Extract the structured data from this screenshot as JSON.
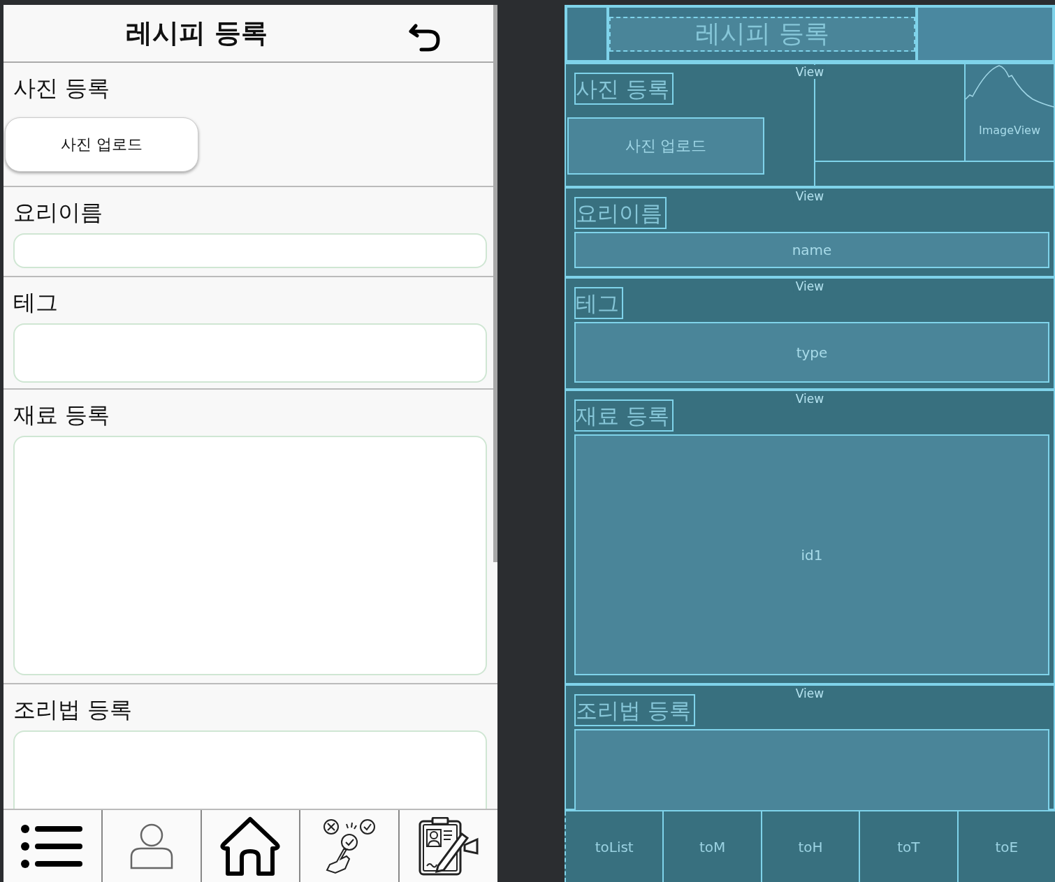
{
  "design": {
    "title": "레시피 등록",
    "sections": [
      {
        "kind": "photo",
        "label": "사진 등록",
        "button": "사진 업로드"
      },
      {
        "kind": "field",
        "label": "요리이름"
      },
      {
        "kind": "field",
        "label": "테그"
      },
      {
        "kind": "field",
        "label": "재료 등록"
      },
      {
        "kind": "field",
        "label": "조리법 등록"
      }
    ]
  },
  "blueprint": {
    "title": "레시피 등록",
    "sections": [
      {
        "kind": "photo",
        "view_label": "View",
        "label": "사진 등록",
        "button": "사진 업로드",
        "image_label": "ImageView"
      },
      {
        "kind": "field",
        "view_label": "View",
        "label": "요리이름",
        "field": "name"
      },
      {
        "kind": "field",
        "view_label": "View",
        "label": "테그",
        "field": "type"
      },
      {
        "kind": "field",
        "view_label": "View",
        "label": "재료 등록",
        "field": "id1"
      },
      {
        "kind": "field",
        "view_label": "View",
        "label": "조리법 등록"
      }
    ],
    "nav": [
      "toList",
      "toM",
      "toH",
      "toT",
      "toE"
    ]
  }
}
